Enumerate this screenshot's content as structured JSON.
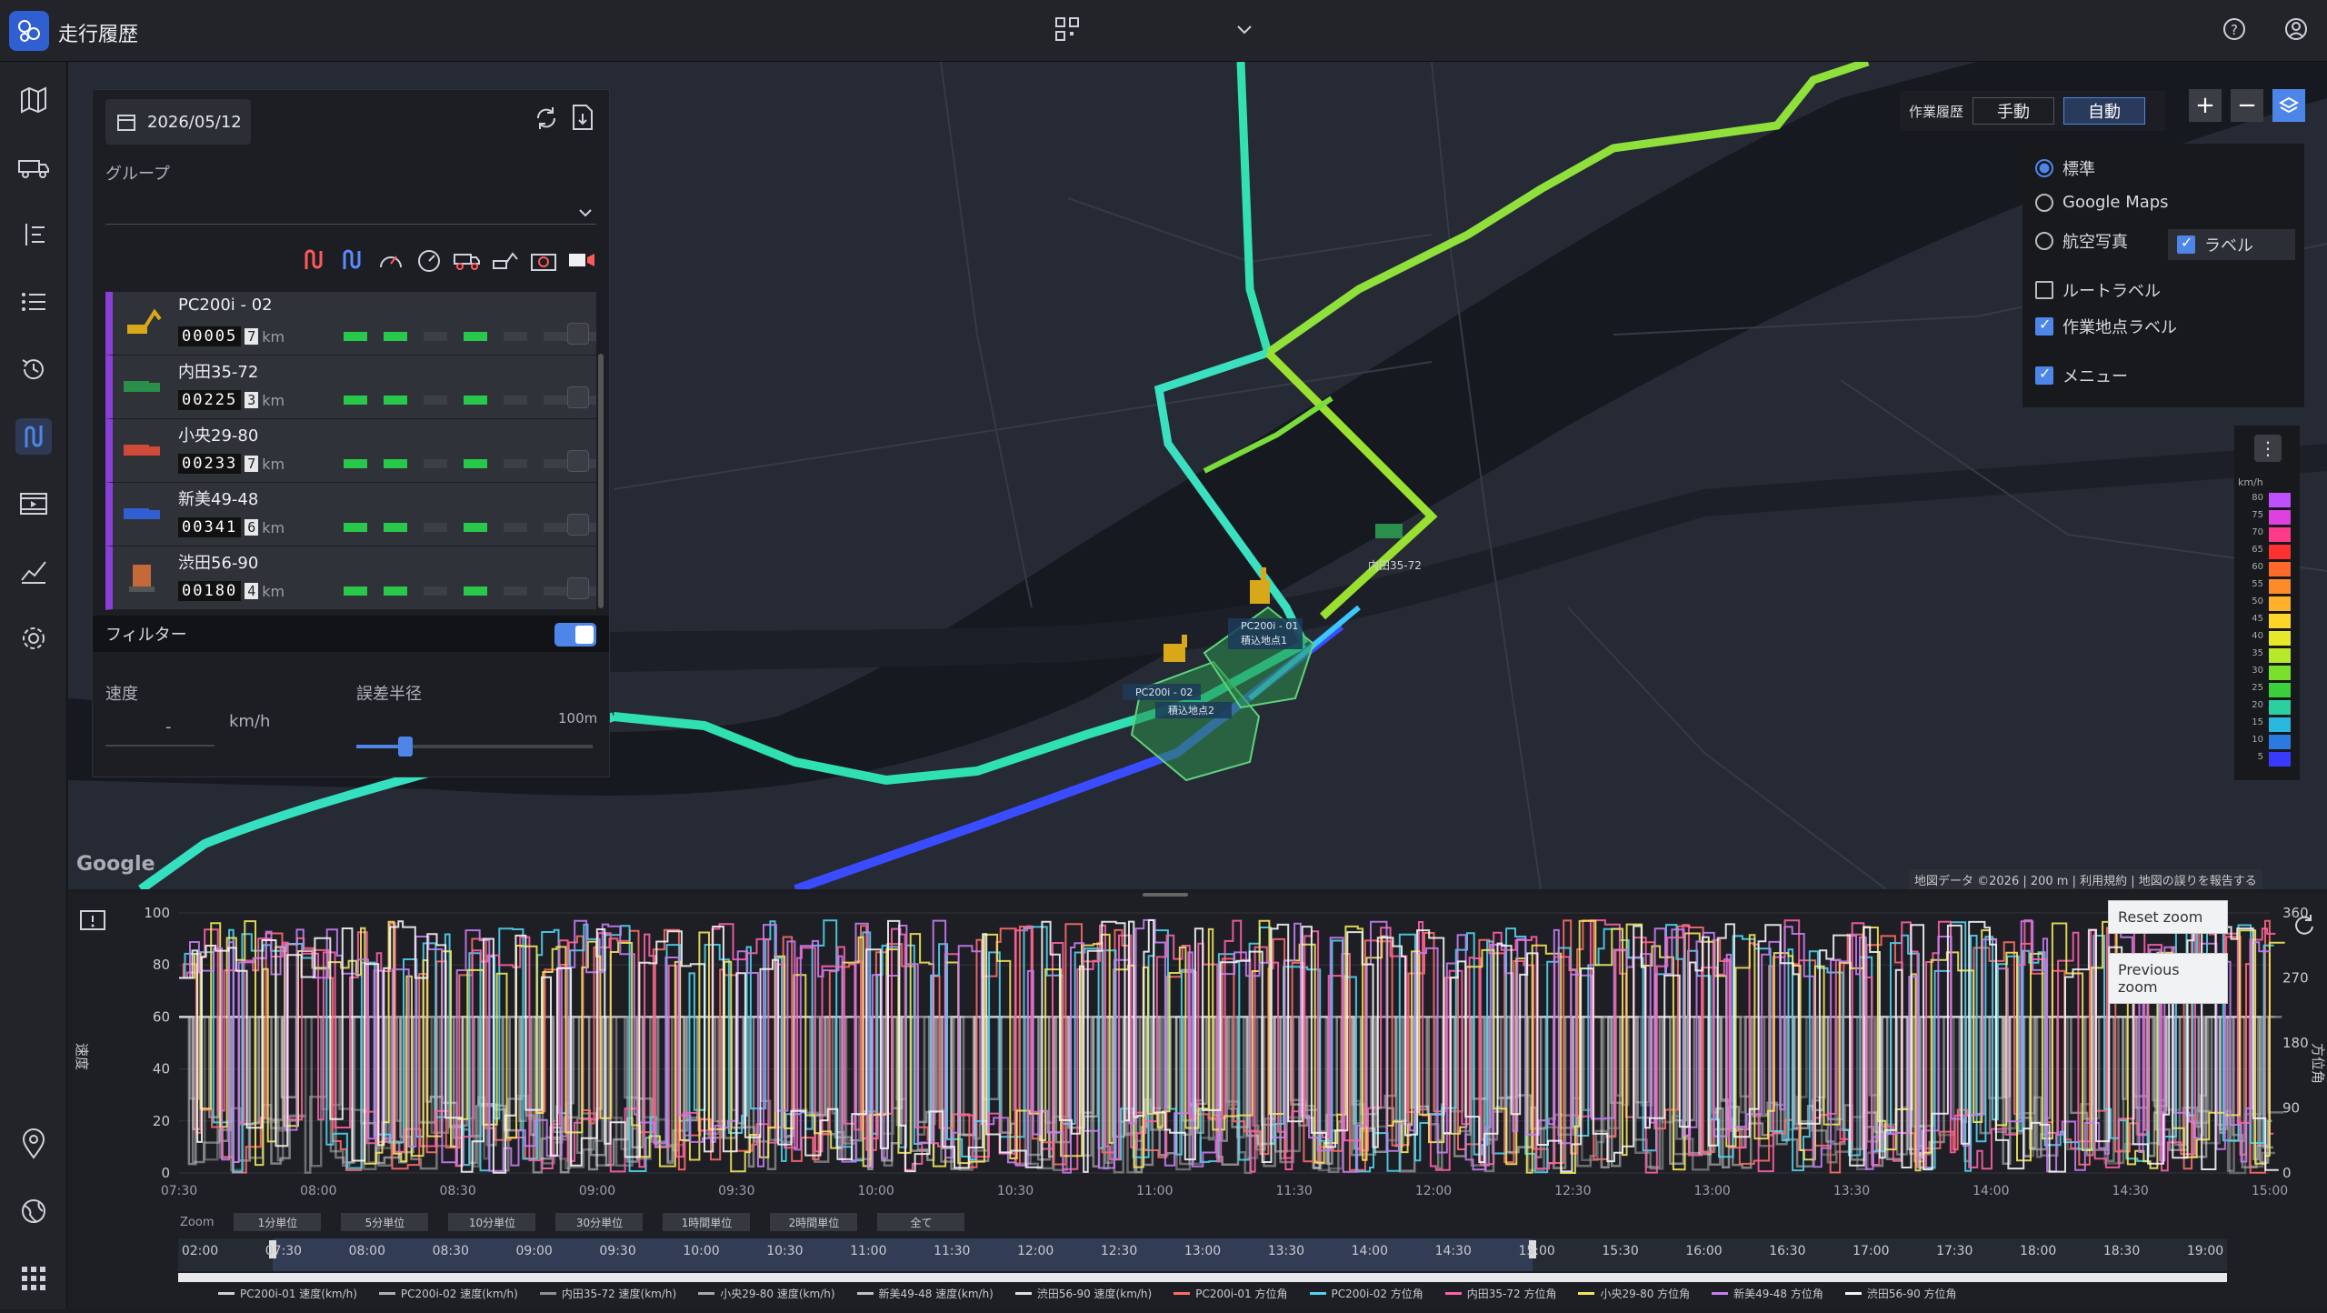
{
  "app": {
    "title": "走行履歴"
  },
  "colors": {
    "accent": "#4d86e8",
    "vehicle_stripe": "#8a3fd6",
    "bar_on": "#28c84a"
  },
  "panel": {
    "date": "2026/05/12",
    "group_label": "グループ",
    "filter_label": "フィルター",
    "speed_label": "速度",
    "speed_sep": "-",
    "speed_unit": "km/h",
    "error_label": "誤差半径",
    "error_max": "100m",
    "km_unit": "km",
    "vehicles": [
      {
        "name": "PC200i - 02",
        "odo": "00005",
        "odo_dec": "7",
        "bars": [
          1,
          1,
          0,
          1,
          0,
          0,
          0
        ]
      },
      {
        "name": "内田35-72",
        "odo": "00225",
        "odo_dec": "3",
        "bars": [
          1,
          1,
          0,
          1,
          0,
          0,
          0
        ]
      },
      {
        "name": "小央29-80",
        "odo": "00233",
        "odo_dec": "7",
        "bars": [
          1,
          1,
          0,
          1,
          0,
          0,
          0
        ]
      },
      {
        "name": "新美49-48",
        "odo": "00341",
        "odo_dec": "6",
        "bars": [
          1,
          1,
          0,
          1,
          0,
          0,
          0
        ]
      },
      {
        "name": "渋田56-90",
        "odo": "00180",
        "odo_dec": "4",
        "bars": [
          1,
          1,
          0,
          1,
          0,
          0,
          0
        ]
      }
    ]
  },
  "map": {
    "mode_label": "作業履歴",
    "mode_manual": "手動",
    "mode_auto": "自動",
    "layers": {
      "standard": "標準",
      "google_maps": "Google Maps",
      "aerial": "航空写真",
      "label": "ラベル",
      "route_label": "ルートラベル",
      "work_label": "作業地点ラベル",
      "menu": "メニュー"
    },
    "marker_labels": {
      "pc01": "PC200i - 01",
      "site1": "積込地点1",
      "pc02": "PC200i - 02",
      "site2": "積込地点2",
      "truck": "内田35-72"
    },
    "google": "Google",
    "attribution": "地図データ ©2026 | 200 m | 利用規約 | 地図の誤りを報告する",
    "speed_legend": {
      "unit": "km/h",
      "ticks": [
        "80",
        "75",
        "70",
        "65",
        "60",
        "55",
        "50",
        "45",
        "40",
        "35",
        "30",
        "25",
        "20",
        "15",
        "10",
        "5"
      ]
    }
  },
  "chart": {
    "reset_zoom": "Reset zoom",
    "previous_zoom": "Previous zoom",
    "zoom_label": "Zoom",
    "zoom_buttons": [
      "1分単位",
      "5分単位",
      "10分単位",
      "30分単位",
      "1時間単位",
      "2時間単位",
      "全て"
    ],
    "nav_ticks": [
      "02:00",
      "07:30",
      "08:00",
      "08:30",
      "09:00",
      "09:30",
      "10:00",
      "10:30",
      "11:00",
      "11:30",
      "12:00",
      "12:30",
      "13:00",
      "13:30",
      "14:00",
      "14:30",
      "15:00",
      "15:30",
      "16:00",
      "16:30",
      "17:00",
      "17:30",
      "18:00",
      "18:30",
      "19:00"
    ]
  },
  "chart_data": {
    "type": "line",
    "x": [
      "07:30",
      "08:00",
      "08:30",
      "09:00",
      "09:30",
      "10:00",
      "10:30",
      "11:00",
      "11:30",
      "12:00",
      "12:30",
      "13:00",
      "13:30",
      "14:00",
      "14:30",
      "15:00"
    ],
    "ylabel": "速度",
    "y2label": "方位角",
    "ylim": [
      0,
      100
    ],
    "y2lim": [
      0,
      360
    ],
    "yticks": [
      "0",
      "20",
      "40",
      "60",
      "80",
      "100"
    ],
    "y2ticks": [
      "0",
      "90",
      "180",
      "270",
      "360"
    ],
    "series": [
      {
        "name": "PC200i-01 速度(km/h)",
        "color": "#d0d0d0"
      },
      {
        "name": "PC200i-02 速度(km/h)",
        "color": "#b0b0b0"
      },
      {
        "name": "内田35-72 速度(km/h)",
        "color": "#909090"
      },
      {
        "name": "小央29-80 速度(km/h)",
        "color": "#a8a8a8"
      },
      {
        "name": "新美49-48 速度(km/h)",
        "color": "#c0c0c0"
      },
      {
        "name": "渋田56-90 速度(km/h)",
        "color": "#e0e0e0"
      },
      {
        "name": "PC200i-01 方位角",
        "color": "#ff6a6a"
      },
      {
        "name": "PC200i-02 方位角",
        "color": "#4fd3f0"
      },
      {
        "name": "内田35-72 方位角",
        "color": "#ff5fa8"
      },
      {
        "name": "小央29-80 方位角",
        "color": "#f2e55a"
      },
      {
        "name": "新美49-48 方位角",
        "color": "#c77cf2"
      },
      {
        "name": "渋田56-90 方位角",
        "color": "#f4f4f4"
      }
    ]
  }
}
